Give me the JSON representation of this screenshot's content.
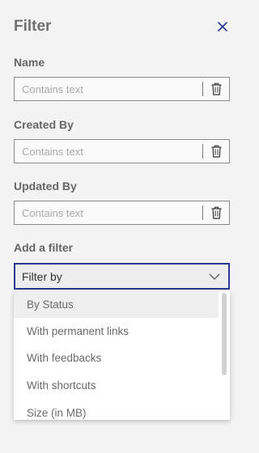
{
  "panel": {
    "title": "Filter",
    "close_icon": "close-icon"
  },
  "fields": [
    {
      "label": "Name",
      "value": "",
      "placeholder": "Contains text",
      "clear_icon": "trash-icon"
    },
    {
      "label": "Created By",
      "value": "",
      "placeholder": "Contains text",
      "clear_icon": "trash-icon"
    },
    {
      "label": "Updated By",
      "value": "",
      "placeholder": "Contains text",
      "clear_icon": "trash-icon"
    }
  ],
  "add_filter": {
    "label": "Add a filter",
    "select_value": "Filter by",
    "expand_icon": "chevron-down-icon",
    "options": [
      "By Status",
      "With permanent links",
      "With feedbacks",
      "With shortcuts",
      "Size (in MB)"
    ],
    "highlighted_index": 0
  },
  "colors": {
    "accent": "#283a8f",
    "background": "#f3f3f3",
    "highlight": "#efefef"
  }
}
